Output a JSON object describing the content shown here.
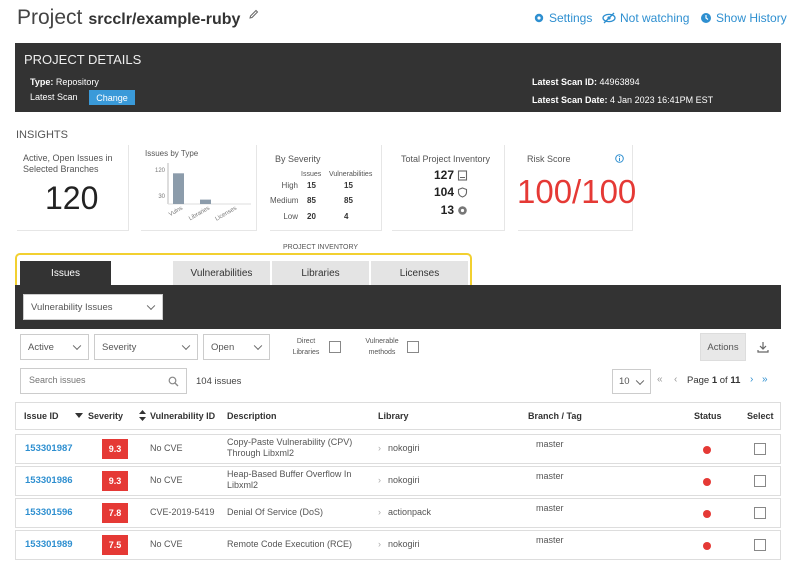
{
  "header": {
    "project_word": "Project",
    "project_name": "srcclr/example-ruby",
    "settings": "Settings",
    "watching": "Not watching",
    "history": "Show History"
  },
  "details": {
    "title": "PROJECT DETAILS",
    "type_label": "Type:",
    "type_value": "Repository",
    "latest_scan_label": "Latest Scan",
    "change_button": "Change",
    "scan_id_label": "Latest Scan ID:",
    "scan_id_value": "44963894",
    "scan_date_label": "Latest Scan Date:",
    "scan_date_value": "4 Jan 2023 16:41PM EST"
  },
  "insights": {
    "title": "INSIGHTS",
    "open_issues": {
      "title": "Active, Open Issues in Selected Branches",
      "value": "120"
    },
    "issues_by_type": {
      "title": "Issues by Type",
      "chart_data": {
        "type": "bar",
        "categories": [
          "Vulns",
          "Libraries",
          "Licenses"
        ],
        "values": [
          105,
          15,
          0
        ],
        "ylim": [
          0,
          130
        ],
        "yticks": [
          "120",
          "30"
        ]
      }
    },
    "by_severity": {
      "title": "By Severity",
      "col_issues": "Issues",
      "col_vulns": "Vulnerabilities",
      "rows": [
        {
          "label": "High",
          "issues": "15",
          "vulns": "15"
        },
        {
          "label": "Medium",
          "issues": "85",
          "vulns": "85"
        },
        {
          "label": "Low",
          "issues": "20",
          "vulns": "4"
        }
      ]
    },
    "inventory": {
      "title": "Total Project Inventory",
      "items": [
        {
          "value": "127",
          "icon": "library-icon"
        },
        {
          "value": "104",
          "icon": "shield-icon"
        },
        {
          "value": "13",
          "icon": "gear-icon"
        }
      ]
    },
    "risk": {
      "title": "Risk Score",
      "value": "100/100",
      "color": "#e53935"
    }
  },
  "inventory_label": "PROJECT INVENTORY",
  "tabs": [
    "Issues",
    "Vulnerabilities",
    "Libraries",
    "Licenses"
  ],
  "issue_type_select": "Vulnerability Issues",
  "filters": {
    "status": "Active",
    "severity": "Severity",
    "state": "Open",
    "direct_libraries": "Direct Libraries",
    "vulnerable_methods": "Vulnerable methods",
    "actions": "Actions"
  },
  "search": {
    "placeholder": "Search issues",
    "count": "104 issues"
  },
  "pagination": {
    "per_page": "10",
    "page_word": "Page",
    "current": "1",
    "of_word": "of",
    "total": "11"
  },
  "columns": [
    "Issue ID",
    "Severity",
    "Vulnerability ID",
    "Description",
    "Library",
    "Branch / Tag",
    "Status",
    "Select"
  ],
  "rows": [
    {
      "id": "153301987",
      "severity": "9.3",
      "vuln_id": "No CVE",
      "desc1": "Copy-Paste Vulnerability (CPV)",
      "desc2": "Through Libxml2",
      "library": "nokogiri",
      "branch": "master"
    },
    {
      "id": "153301986",
      "severity": "9.3",
      "vuln_id": "No CVE",
      "desc1": "Heap-Based Buffer Overflow In",
      "desc2": "Libxml2",
      "library": "nokogiri",
      "branch": "master"
    },
    {
      "id": "153301596",
      "severity": "7.8",
      "vuln_id": "CVE-2019-5419",
      "desc1": "Denial Of Service (DoS)",
      "desc2": "",
      "library": "actionpack",
      "branch": "master"
    },
    {
      "id": "153301989",
      "severity": "7.5",
      "vuln_id": "No CVE",
      "desc1": "Remote Code Execution (RCE)",
      "desc2": "",
      "library": "nokogiri",
      "branch": "master"
    }
  ],
  "colors": {
    "accent": "#2e8fd0",
    "dark": "#333333",
    "danger": "#e53935",
    "highlight": "#f2d030"
  }
}
